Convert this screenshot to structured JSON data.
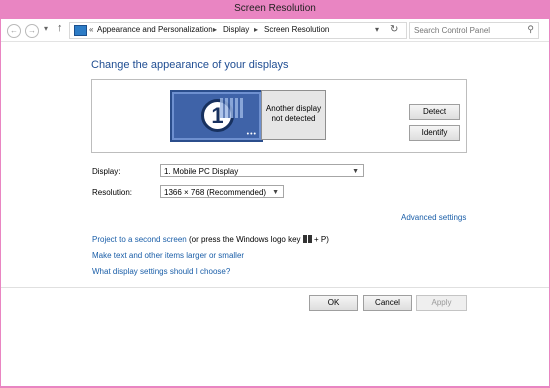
{
  "window": {
    "title": "Screen Resolution"
  },
  "addressbar": {
    "breadcrumb_chevrons": "«",
    "items": [
      "Appearance and Personalization",
      "Display",
      "Screen Resolution"
    ],
    "search_placeholder": "Search Control Panel"
  },
  "main": {
    "heading": "Change the appearance of your displays",
    "monitor_primary_number": "1",
    "monitor_secondary_text": "Another display not detected",
    "detect_label": "Detect",
    "identify_label": "Identify",
    "display_label": "Display:",
    "display_value": "1. Mobile PC Display",
    "resolution_label": "Resolution:",
    "resolution_value": "1366 × 768 (Recommended)",
    "advanced_link": "Advanced settings",
    "project_link": "Project to a second screen",
    "project_rest_prefix": "(or press the Windows logo key",
    "project_rest_suffix": "+ P)",
    "larger_link": "Make text and other items larger or smaller",
    "help_link": "What display settings should I choose?"
  },
  "buttons": {
    "ok": "OK",
    "cancel": "Cancel",
    "apply": "Apply"
  }
}
